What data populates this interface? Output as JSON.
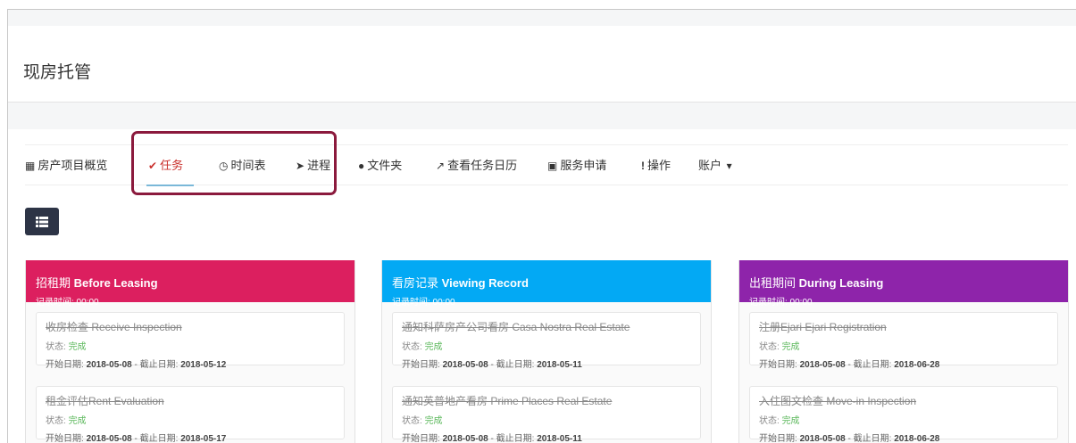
{
  "page": {
    "title": "现房托管"
  },
  "tabs": [
    {
      "icon": "grid-icon",
      "glyph": "▦",
      "label": "房产项目概览"
    },
    {
      "icon": "check-circle-icon",
      "glyph": "✔",
      "label": "任务",
      "active": true
    },
    {
      "icon": "clock-icon",
      "glyph": "◷",
      "label": "时间表"
    },
    {
      "icon": "rocket-icon",
      "glyph": "➤",
      "label": "进程"
    },
    {
      "icon": "comment-icon",
      "glyph": "●",
      "label": "文件夹"
    },
    {
      "icon": "line-chart-icon",
      "glyph": "↗",
      "label": "查看任务日历"
    },
    {
      "icon": "id-card-icon",
      "glyph": "▣",
      "label": "服务申请"
    },
    {
      "icon": "exclamation-icon",
      "glyph": "!",
      "label": "操作"
    },
    {
      "icon": "caret-down-icon",
      "glyph": "▾",
      "label": "账户"
    }
  ],
  "toolbar": {
    "list_button_icon": "list-icon"
  },
  "colors": {
    "pink": "#dc1f5f",
    "blue": "#03a9f4",
    "purple": "#8e24aa",
    "done": "#5cb85c",
    "highlight": "#8b1a3d"
  },
  "columns": [
    {
      "title_cn": "招租期",
      "title_en": "Before Leasing",
      "recorded": "记录时间: 00:00",
      "color": "#dc1f5f",
      "cards": [
        {
          "title": "收房检查 Receive Inspection",
          "status_label": "状态:",
          "status": "完成",
          "start_label": "开始日期:",
          "start": "2018-05-08",
          "sep": "-",
          "end_label": "截止日期:",
          "end": "2018-05-12"
        },
        {
          "title": "租金评估Rent Evaluation",
          "status_label": "状态:",
          "status": "完成",
          "start_label": "开始日期:",
          "start": "2018-05-08",
          "sep": "-",
          "end_label": "截止日期:",
          "end": "2018-05-17"
        }
      ]
    },
    {
      "title_cn": "看房记录",
      "title_en": "Viewing Record",
      "recorded": "记录时间: 00:00",
      "color": "#03a9f4",
      "cards": [
        {
          "title": "通知科萨房产公司看房 Casa Nostra Real Estate",
          "status_label": "状态:",
          "status": "完成",
          "start_label": "开始日期:",
          "start": "2018-05-08",
          "sep": "-",
          "end_label": "截止日期:",
          "end": "2018-05-11"
        },
        {
          "title": "通知英普地产看房 Prime Places Real Estate",
          "status_label": "状态:",
          "status": "完成",
          "start_label": "开始日期:",
          "start": "2018-05-08",
          "sep": "-",
          "end_label": "截止日期:",
          "end": "2018-05-11"
        }
      ]
    },
    {
      "title_cn": "出租期间",
      "title_en": "During Leasing",
      "recorded": "记录时间: 00:00",
      "color": "#8e24aa",
      "cards": [
        {
          "title": "注册Ejari Ejari Registration",
          "status_label": "状态:",
          "status": "完成",
          "start_label": "开始日期:",
          "start": "2018-05-08",
          "sep": "-",
          "end_label": "截止日期:",
          "end": "2018-06-28"
        },
        {
          "title": "入住图文检查 Move-in Inspection",
          "status_label": "状态:",
          "status": "完成",
          "start_label": "开始日期:",
          "start": "2018-05-08",
          "sep": "-",
          "end_label": "截止日期:",
          "end": "2018-06-28"
        }
      ]
    }
  ]
}
